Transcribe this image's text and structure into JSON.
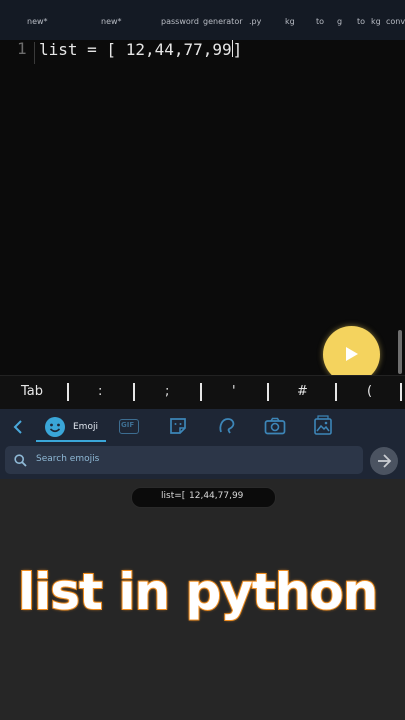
{
  "tabs": [
    "new*",
    "new*",
    "password",
    "generator",
    ".py",
    "kg",
    "to",
    "g",
    "to",
    "kg",
    "conve"
  ],
  "editor": {
    "line_number": "1",
    "code": "list = [ 12,44,77,99",
    "code_end": "]"
  },
  "symbols": [
    "Tab",
    ":",
    ";",
    "'",
    "#",
    "("
  ],
  "keyboard": {
    "emoji_label": "Emoji",
    "gif_label": "GIF",
    "search_placeholder": "Search emojis",
    "accent_color": "#3aa6d8"
  },
  "overlay": {
    "pill_left": "list=[",
    "pill_right": "12,44,77,99",
    "caption": "list in python",
    "caption_outline": "#f19125"
  },
  "run_button_color": "#f4d35e"
}
